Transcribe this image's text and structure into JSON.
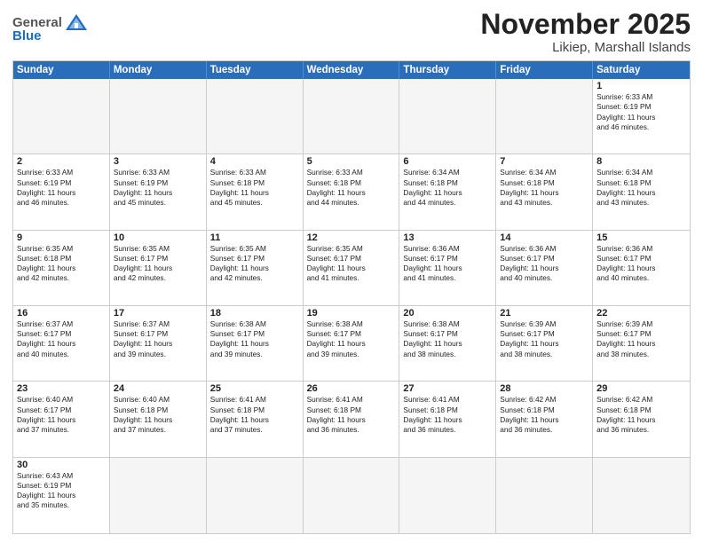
{
  "header": {
    "logo_general": "General",
    "logo_blue": "Blue",
    "month": "November 2025",
    "location": "Likiep, Marshall Islands"
  },
  "weekdays": [
    "Sunday",
    "Monday",
    "Tuesday",
    "Wednesday",
    "Thursday",
    "Friday",
    "Saturday"
  ],
  "weeks": [
    [
      {
        "day": "",
        "empty": true,
        "info": ""
      },
      {
        "day": "",
        "empty": true,
        "info": ""
      },
      {
        "day": "",
        "empty": true,
        "info": ""
      },
      {
        "day": "",
        "empty": true,
        "info": ""
      },
      {
        "day": "",
        "empty": true,
        "info": ""
      },
      {
        "day": "",
        "empty": true,
        "info": ""
      },
      {
        "day": "1",
        "empty": false,
        "info": "Sunrise: 6:33 AM\nSunset: 6:19 PM\nDaylight: 11 hours\nand 46 minutes."
      }
    ],
    [
      {
        "day": "2",
        "empty": false,
        "info": "Sunrise: 6:33 AM\nSunset: 6:19 PM\nDaylight: 11 hours\nand 46 minutes."
      },
      {
        "day": "3",
        "empty": false,
        "info": "Sunrise: 6:33 AM\nSunset: 6:19 PM\nDaylight: 11 hours\nand 45 minutes."
      },
      {
        "day": "4",
        "empty": false,
        "info": "Sunrise: 6:33 AM\nSunset: 6:18 PM\nDaylight: 11 hours\nand 45 minutes."
      },
      {
        "day": "5",
        "empty": false,
        "info": "Sunrise: 6:33 AM\nSunset: 6:18 PM\nDaylight: 11 hours\nand 44 minutes."
      },
      {
        "day": "6",
        "empty": false,
        "info": "Sunrise: 6:34 AM\nSunset: 6:18 PM\nDaylight: 11 hours\nand 44 minutes."
      },
      {
        "day": "7",
        "empty": false,
        "info": "Sunrise: 6:34 AM\nSunset: 6:18 PM\nDaylight: 11 hours\nand 43 minutes."
      },
      {
        "day": "8",
        "empty": false,
        "info": "Sunrise: 6:34 AM\nSunset: 6:18 PM\nDaylight: 11 hours\nand 43 minutes."
      }
    ],
    [
      {
        "day": "9",
        "empty": false,
        "info": "Sunrise: 6:35 AM\nSunset: 6:18 PM\nDaylight: 11 hours\nand 42 minutes."
      },
      {
        "day": "10",
        "empty": false,
        "info": "Sunrise: 6:35 AM\nSunset: 6:17 PM\nDaylight: 11 hours\nand 42 minutes."
      },
      {
        "day": "11",
        "empty": false,
        "info": "Sunrise: 6:35 AM\nSunset: 6:17 PM\nDaylight: 11 hours\nand 42 minutes."
      },
      {
        "day": "12",
        "empty": false,
        "info": "Sunrise: 6:35 AM\nSunset: 6:17 PM\nDaylight: 11 hours\nand 41 minutes."
      },
      {
        "day": "13",
        "empty": false,
        "info": "Sunrise: 6:36 AM\nSunset: 6:17 PM\nDaylight: 11 hours\nand 41 minutes."
      },
      {
        "day": "14",
        "empty": false,
        "info": "Sunrise: 6:36 AM\nSunset: 6:17 PM\nDaylight: 11 hours\nand 40 minutes."
      },
      {
        "day": "15",
        "empty": false,
        "info": "Sunrise: 6:36 AM\nSunset: 6:17 PM\nDaylight: 11 hours\nand 40 minutes."
      }
    ],
    [
      {
        "day": "16",
        "empty": false,
        "info": "Sunrise: 6:37 AM\nSunset: 6:17 PM\nDaylight: 11 hours\nand 40 minutes."
      },
      {
        "day": "17",
        "empty": false,
        "info": "Sunrise: 6:37 AM\nSunset: 6:17 PM\nDaylight: 11 hours\nand 39 minutes."
      },
      {
        "day": "18",
        "empty": false,
        "info": "Sunrise: 6:38 AM\nSunset: 6:17 PM\nDaylight: 11 hours\nand 39 minutes."
      },
      {
        "day": "19",
        "empty": false,
        "info": "Sunrise: 6:38 AM\nSunset: 6:17 PM\nDaylight: 11 hours\nand 39 minutes."
      },
      {
        "day": "20",
        "empty": false,
        "info": "Sunrise: 6:38 AM\nSunset: 6:17 PM\nDaylight: 11 hours\nand 38 minutes."
      },
      {
        "day": "21",
        "empty": false,
        "info": "Sunrise: 6:39 AM\nSunset: 6:17 PM\nDaylight: 11 hours\nand 38 minutes."
      },
      {
        "day": "22",
        "empty": false,
        "info": "Sunrise: 6:39 AM\nSunset: 6:17 PM\nDaylight: 11 hours\nand 38 minutes."
      }
    ],
    [
      {
        "day": "23",
        "empty": false,
        "info": "Sunrise: 6:40 AM\nSunset: 6:17 PM\nDaylight: 11 hours\nand 37 minutes."
      },
      {
        "day": "24",
        "empty": false,
        "info": "Sunrise: 6:40 AM\nSunset: 6:18 PM\nDaylight: 11 hours\nand 37 minutes."
      },
      {
        "day": "25",
        "empty": false,
        "info": "Sunrise: 6:41 AM\nSunset: 6:18 PM\nDaylight: 11 hours\nand 37 minutes."
      },
      {
        "day": "26",
        "empty": false,
        "info": "Sunrise: 6:41 AM\nSunset: 6:18 PM\nDaylight: 11 hours\nand 36 minutes."
      },
      {
        "day": "27",
        "empty": false,
        "info": "Sunrise: 6:41 AM\nSunset: 6:18 PM\nDaylight: 11 hours\nand 36 minutes."
      },
      {
        "day": "28",
        "empty": false,
        "info": "Sunrise: 6:42 AM\nSunset: 6:18 PM\nDaylight: 11 hours\nand 36 minutes."
      },
      {
        "day": "29",
        "empty": false,
        "info": "Sunrise: 6:42 AM\nSunset: 6:18 PM\nDaylight: 11 hours\nand 36 minutes."
      }
    ],
    [
      {
        "day": "30",
        "empty": false,
        "info": "Sunrise: 6:43 AM\nSunset: 6:19 PM\nDaylight: 11 hours\nand 35 minutes."
      },
      {
        "day": "",
        "empty": true,
        "info": ""
      },
      {
        "day": "",
        "empty": true,
        "info": ""
      },
      {
        "day": "",
        "empty": true,
        "info": ""
      },
      {
        "day": "",
        "empty": true,
        "info": ""
      },
      {
        "day": "",
        "empty": true,
        "info": ""
      },
      {
        "day": "",
        "empty": true,
        "info": ""
      }
    ]
  ]
}
